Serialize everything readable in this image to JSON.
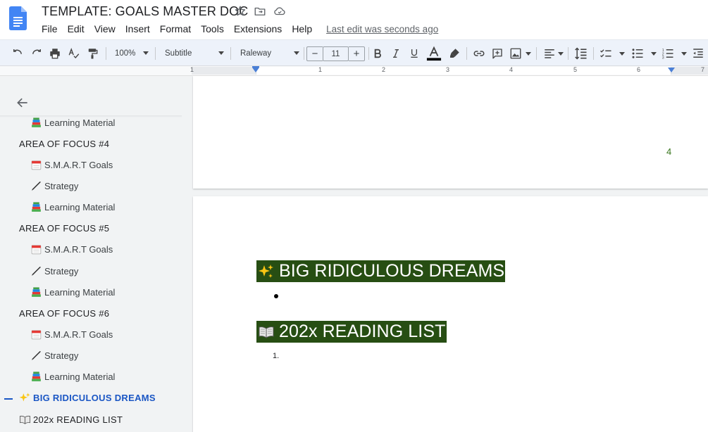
{
  "document": {
    "title": "TEMPLATE: GOALS MASTER DOC",
    "last_edit": "Last edit was seconds ago",
    "page_number": "4"
  },
  "menu": {
    "items": [
      "File",
      "Edit",
      "View",
      "Insert",
      "Format",
      "Tools",
      "Extensions",
      "Help"
    ]
  },
  "toolbar": {
    "zoom": "100%",
    "style": "Subtitle",
    "font": "Raleway",
    "font_size": "11",
    "minus": "−",
    "plus": "+",
    "text_color": "#000000"
  },
  "ruler": {
    "labels": [
      "1",
      "1",
      "2",
      "3",
      "4",
      "5",
      "6",
      "7"
    ]
  },
  "outline": {
    "items": [
      {
        "label": "Learning Material",
        "level": 2,
        "icon": "books-icon"
      },
      {
        "label": "AREA OF FOCUS #4",
        "level": 1
      },
      {
        "label": "S.M.A.R.T Goals",
        "level": 2,
        "icon": "calendar-icon"
      },
      {
        "label": "Strategy",
        "level": 2,
        "icon": "pen-icon"
      },
      {
        "label": "Learning Material",
        "level": 2,
        "icon": "books-icon"
      },
      {
        "label": "AREA OF FOCUS #5",
        "level": 1
      },
      {
        "label": "S.M.A.R.T Goals",
        "level": 2,
        "icon": "calendar-icon"
      },
      {
        "label": "Strategy",
        "level": 2,
        "icon": "pen-icon"
      },
      {
        "label": "Learning Material",
        "level": 2,
        "icon": "books-icon"
      },
      {
        "label": "AREA OF FOCUS #6",
        "level": 1
      },
      {
        "label": "S.M.A.R.T Goals",
        "level": 2,
        "icon": "calendar-icon"
      },
      {
        "label": "Strategy",
        "level": 2,
        "icon": "pen-icon"
      },
      {
        "label": "Learning Material",
        "level": 2,
        "icon": "books-icon"
      },
      {
        "label": "BIG RIDICULOUS DREAMS",
        "level": 1,
        "icon": "sparkles-icon",
        "active": true
      },
      {
        "label": "202x READING LIST",
        "level": 1,
        "icon": "open-book-icon"
      }
    ]
  },
  "content": {
    "heading1": "BIG RIDICULOUS DREAMS",
    "heading2": "202x READING LIST",
    "list_number": "1.",
    "heading_bg": "#274e13",
    "active_color": "#1a56c4"
  }
}
